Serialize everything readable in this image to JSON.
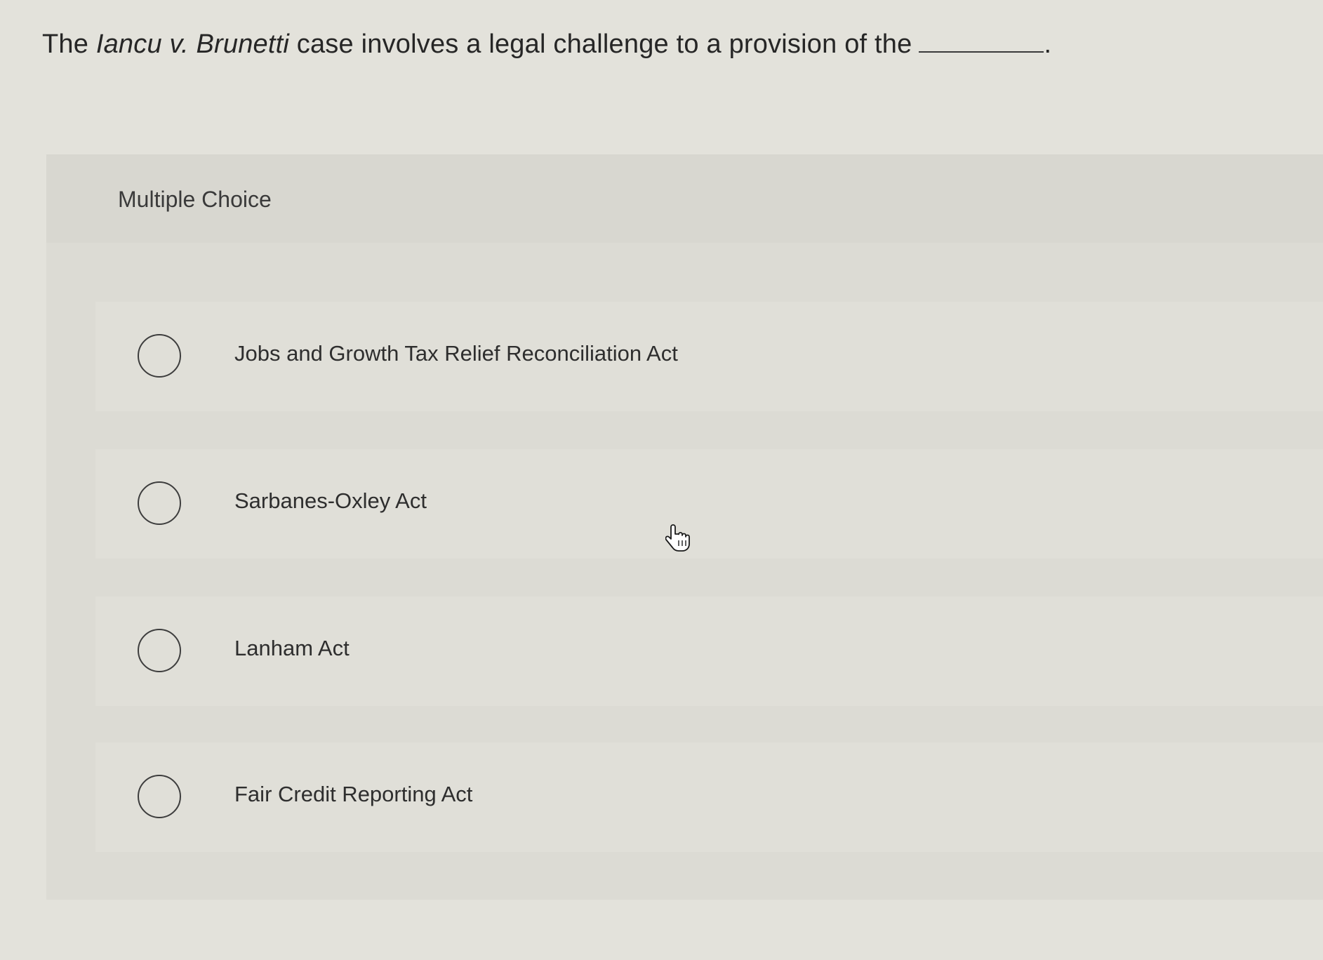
{
  "question": {
    "prefix": "The ",
    "case_name": "Iancu v. Brunetti",
    "suffix": " case involves a legal challenge to a provision of the",
    "end": "."
  },
  "panel": {
    "title": "Multiple Choice"
  },
  "options": [
    {
      "label": "Jobs and Growth Tax Relief Reconciliation Act"
    },
    {
      "label": "Sarbanes-Oxley Act"
    },
    {
      "label": "Lanham Act"
    },
    {
      "label": "Fair Credit Reporting Act"
    }
  ],
  "icons": {
    "radio": "radio-unchecked-icon",
    "cursor": "hand-pointer-icon"
  }
}
